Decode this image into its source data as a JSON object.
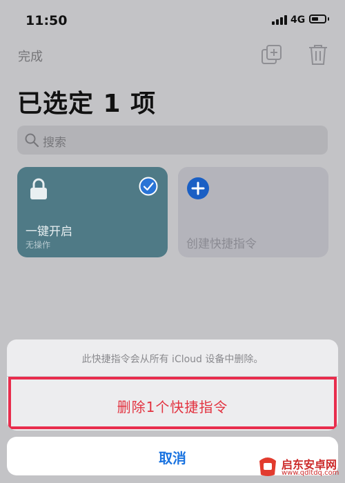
{
  "status_bar": {
    "time": "11:50",
    "network": "4G"
  },
  "header": {
    "done_label": "完成",
    "title": "已选定 1 项"
  },
  "search": {
    "placeholder": "搜索"
  },
  "shortcuts": [
    {
      "title": "一键开启",
      "subtitle": "无操作",
      "selected": true,
      "icon": "lock-icon",
      "color": "#4f7a86"
    },
    {
      "title": "创建快捷指令",
      "icon": "plus-icon",
      "color": "#b4b4bb"
    }
  ],
  "action_sheet": {
    "message": "此快捷指令会从所有 iCloud 设备中删除。",
    "delete_label": "删除1个快捷指令",
    "cancel_label": "取消",
    "delete_color": "#e23340",
    "cancel_color": "#1a73e0",
    "highlight_color": "#e82d4d"
  },
  "watermark": {
    "text": "启东安卓网",
    "url": "www.qdltdq.com"
  }
}
